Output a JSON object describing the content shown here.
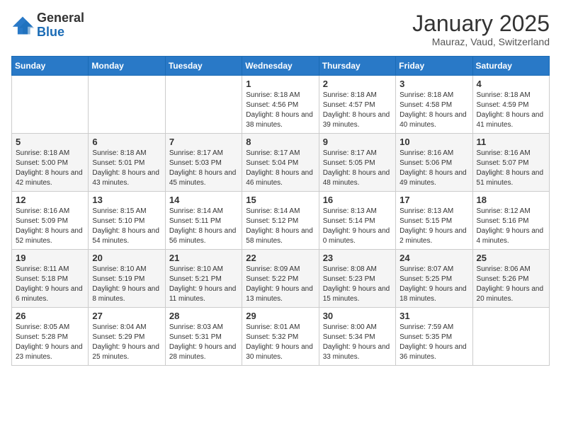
{
  "logo": {
    "general": "General",
    "blue": "Blue"
  },
  "header": {
    "month": "January 2025",
    "location": "Mauraz, Vaud, Switzerland"
  },
  "weekdays": [
    "Sunday",
    "Monday",
    "Tuesday",
    "Wednesday",
    "Thursday",
    "Friday",
    "Saturday"
  ],
  "weeks": [
    [
      null,
      null,
      null,
      {
        "day": 1,
        "sunrise": "8:18 AM",
        "sunset": "4:56 PM",
        "daylight": "8 hours and 38 minutes."
      },
      {
        "day": 2,
        "sunrise": "8:18 AM",
        "sunset": "4:57 PM",
        "daylight": "8 hours and 39 minutes."
      },
      {
        "day": 3,
        "sunrise": "8:18 AM",
        "sunset": "4:58 PM",
        "daylight": "8 hours and 40 minutes."
      },
      {
        "day": 4,
        "sunrise": "8:18 AM",
        "sunset": "4:59 PM",
        "daylight": "8 hours and 41 minutes."
      }
    ],
    [
      {
        "day": 5,
        "sunrise": "8:18 AM",
        "sunset": "5:00 PM",
        "daylight": "8 hours and 42 minutes."
      },
      {
        "day": 6,
        "sunrise": "8:18 AM",
        "sunset": "5:01 PM",
        "daylight": "8 hours and 43 minutes."
      },
      {
        "day": 7,
        "sunrise": "8:17 AM",
        "sunset": "5:03 PM",
        "daylight": "8 hours and 45 minutes."
      },
      {
        "day": 8,
        "sunrise": "8:17 AM",
        "sunset": "5:04 PM",
        "daylight": "8 hours and 46 minutes."
      },
      {
        "day": 9,
        "sunrise": "8:17 AM",
        "sunset": "5:05 PM",
        "daylight": "8 hours and 48 minutes."
      },
      {
        "day": 10,
        "sunrise": "8:16 AM",
        "sunset": "5:06 PM",
        "daylight": "8 hours and 49 minutes."
      },
      {
        "day": 11,
        "sunrise": "8:16 AM",
        "sunset": "5:07 PM",
        "daylight": "8 hours and 51 minutes."
      }
    ],
    [
      {
        "day": 12,
        "sunrise": "8:16 AM",
        "sunset": "5:09 PM",
        "daylight": "8 hours and 52 minutes."
      },
      {
        "day": 13,
        "sunrise": "8:15 AM",
        "sunset": "5:10 PM",
        "daylight": "8 hours and 54 minutes."
      },
      {
        "day": 14,
        "sunrise": "8:14 AM",
        "sunset": "5:11 PM",
        "daylight": "8 hours and 56 minutes."
      },
      {
        "day": 15,
        "sunrise": "8:14 AM",
        "sunset": "5:12 PM",
        "daylight": "8 hours and 58 minutes."
      },
      {
        "day": 16,
        "sunrise": "8:13 AM",
        "sunset": "5:14 PM",
        "daylight": "9 hours and 0 minutes."
      },
      {
        "day": 17,
        "sunrise": "8:13 AM",
        "sunset": "5:15 PM",
        "daylight": "9 hours and 2 minutes."
      },
      {
        "day": 18,
        "sunrise": "8:12 AM",
        "sunset": "5:16 PM",
        "daylight": "9 hours and 4 minutes."
      }
    ],
    [
      {
        "day": 19,
        "sunrise": "8:11 AM",
        "sunset": "5:18 PM",
        "daylight": "9 hours and 6 minutes."
      },
      {
        "day": 20,
        "sunrise": "8:10 AM",
        "sunset": "5:19 PM",
        "daylight": "9 hours and 8 minutes."
      },
      {
        "day": 21,
        "sunrise": "8:10 AM",
        "sunset": "5:21 PM",
        "daylight": "9 hours and 11 minutes."
      },
      {
        "day": 22,
        "sunrise": "8:09 AM",
        "sunset": "5:22 PM",
        "daylight": "9 hours and 13 minutes."
      },
      {
        "day": 23,
        "sunrise": "8:08 AM",
        "sunset": "5:23 PM",
        "daylight": "9 hours and 15 minutes."
      },
      {
        "day": 24,
        "sunrise": "8:07 AM",
        "sunset": "5:25 PM",
        "daylight": "9 hours and 18 minutes."
      },
      {
        "day": 25,
        "sunrise": "8:06 AM",
        "sunset": "5:26 PM",
        "daylight": "9 hours and 20 minutes."
      }
    ],
    [
      {
        "day": 26,
        "sunrise": "8:05 AM",
        "sunset": "5:28 PM",
        "daylight": "9 hours and 23 minutes."
      },
      {
        "day": 27,
        "sunrise": "8:04 AM",
        "sunset": "5:29 PM",
        "daylight": "9 hours and 25 minutes."
      },
      {
        "day": 28,
        "sunrise": "8:03 AM",
        "sunset": "5:31 PM",
        "daylight": "9 hours and 28 minutes."
      },
      {
        "day": 29,
        "sunrise": "8:01 AM",
        "sunset": "5:32 PM",
        "daylight": "9 hours and 30 minutes."
      },
      {
        "day": 30,
        "sunrise": "8:00 AM",
        "sunset": "5:34 PM",
        "daylight": "9 hours and 33 minutes."
      },
      {
        "day": 31,
        "sunrise": "7:59 AM",
        "sunset": "5:35 PM",
        "daylight": "9 hours and 36 minutes."
      },
      null
    ]
  ],
  "labels": {
    "sunrise_prefix": "Sunrise: ",
    "sunset_prefix": "Sunset: ",
    "daylight_prefix": "Daylight: "
  }
}
